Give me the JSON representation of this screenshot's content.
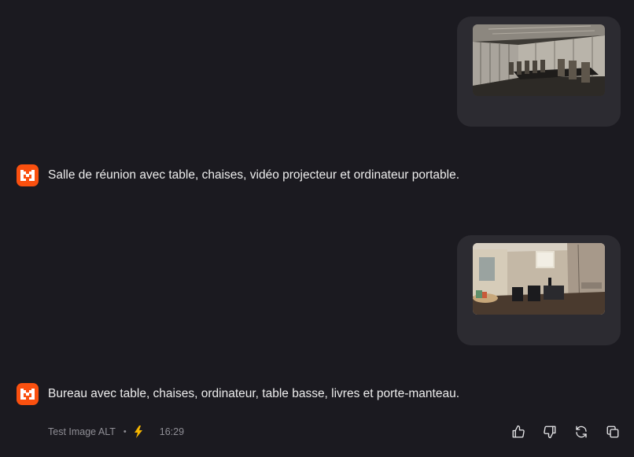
{
  "messages": [
    {
      "role": "user",
      "image": {
        "icon": "conference-room-photo"
      }
    },
    {
      "role": "assistant",
      "avatar_icon": "mistral-logo-icon",
      "text": "Salle de réunion avec table, chaises, vidéo projecteur et ordinateur portable."
    },
    {
      "role": "user",
      "image": {
        "icon": "office-room-photo"
      }
    },
    {
      "role": "assistant",
      "avatar_icon": "mistral-logo-icon",
      "text": "Bureau avec table, chaises, ordinateur, table basse, livres et porte-manteau."
    }
  ],
  "meta": {
    "agent_name": "Test Image ALT",
    "separator": "•",
    "mode_icon": "lightning-bolt-icon",
    "time": "16:29"
  },
  "actions": [
    {
      "icon": "thumbs-up-icon"
    },
    {
      "icon": "thumbs-down-icon"
    },
    {
      "icon": "regenerate-icon"
    },
    {
      "icon": "copy-icon"
    }
  ],
  "colors": {
    "background": "#1b1a20",
    "user_bubble": "#2c2b31",
    "avatar": "#fa500f",
    "bolt": "#f5b500",
    "text": "#ededed",
    "muted": "#8f8e95"
  }
}
